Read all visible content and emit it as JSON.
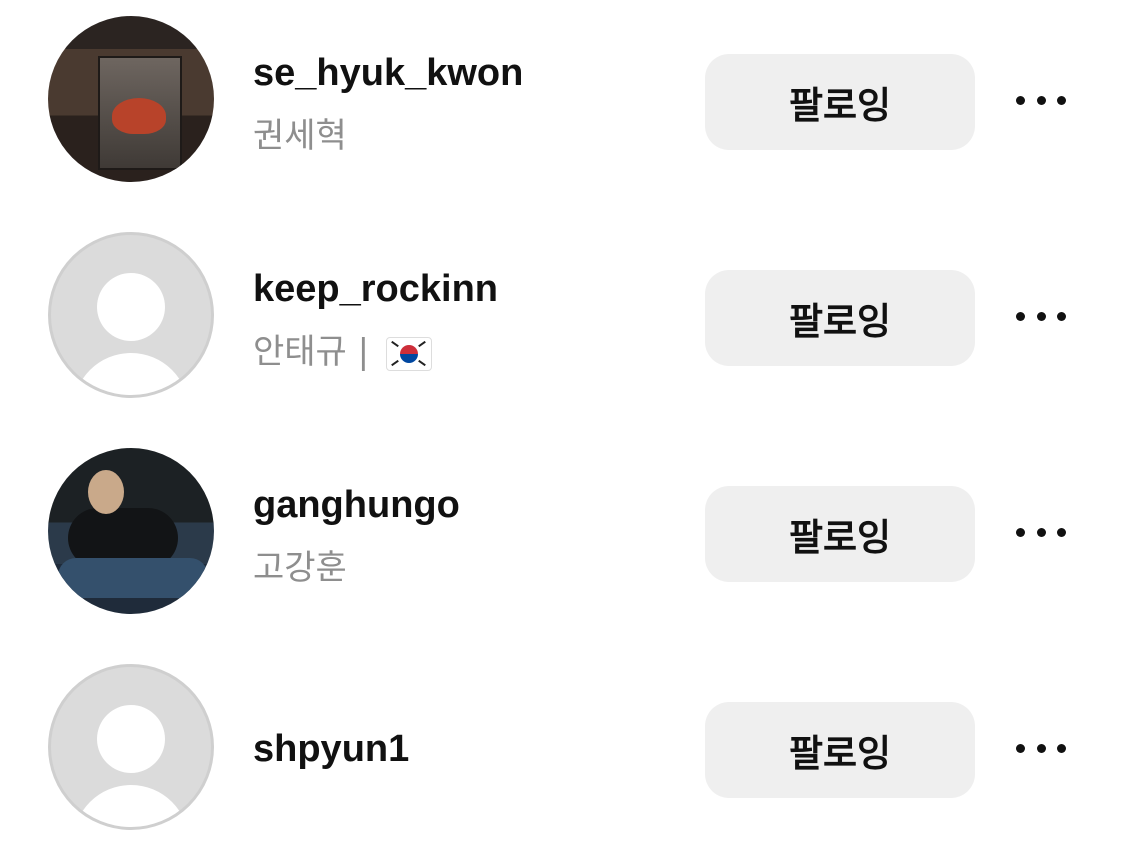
{
  "follow_list": [
    {
      "username": "se_hyuk_kwon",
      "full_name": "권세혁",
      "avatar": "photo-rolling-stones-poster",
      "button": "팔로잉",
      "more_icon": "more-horizontal-icon"
    },
    {
      "username": "keep_rockinn",
      "full_name": "안태규 |",
      "flag": "south-korea-flag-emoji",
      "avatar": "default-avatar",
      "button": "팔로잉",
      "more_icon": "more-horizontal-icon"
    },
    {
      "username": "ganghungo",
      "full_name": "고강훈",
      "avatar": "photo-person-on-couch",
      "button": "팔로잉",
      "more_icon": "more-horizontal-icon"
    },
    {
      "username": "shpyun1",
      "full_name": "",
      "avatar": "default-avatar",
      "button": "팔로잉",
      "more_icon": "more-horizontal-icon"
    }
  ],
  "colors": {
    "button_bg": "#efefef",
    "secondary_text": "#8e8e8e",
    "placeholder_avatar": "#dbdbdb"
  }
}
